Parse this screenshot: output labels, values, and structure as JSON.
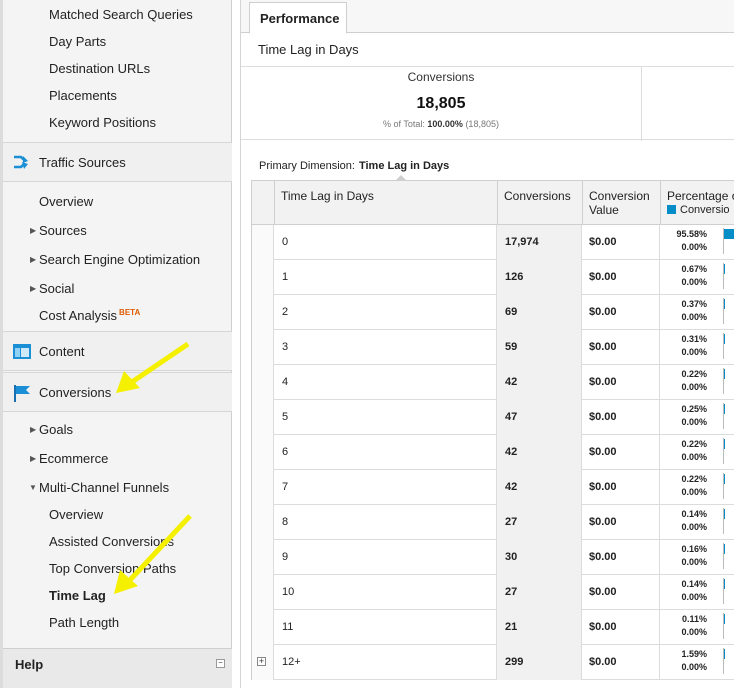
{
  "sidebar": {
    "top_items": [
      "Matched Search Queries",
      "Day Parts",
      "Destination URLs",
      "Placements",
      "Keyword Positions"
    ],
    "traffic_sources": {
      "label": "Traffic Sources",
      "items": [
        {
          "label": "Overview",
          "expandable": false
        },
        {
          "label": "Sources",
          "expandable": true
        },
        {
          "label": "Search Engine Optimization",
          "expandable": true
        },
        {
          "label": "Social",
          "expandable": true
        },
        {
          "label": "Cost Analysis",
          "expandable": false,
          "badge": "BETA"
        }
      ]
    },
    "content": {
      "label": "Content"
    },
    "conversions": {
      "label": "Conversions",
      "items": [
        {
          "label": "Goals",
          "expandable": true
        },
        {
          "label": "Ecommerce",
          "expandable": true
        },
        {
          "label": "Multi-Channel Funnels",
          "expanded": true
        }
      ],
      "mcf_items": [
        "Overview",
        "Assisted Conversions",
        "Top Conversion Paths",
        "Time Lag",
        "Path Length"
      ],
      "active_item": "Time Lag"
    },
    "help": {
      "label": "Help"
    }
  },
  "main": {
    "tab": "Performance",
    "report_title": "Time Lag in Days",
    "summary": {
      "label": "Conversions",
      "value": "18,805",
      "total_prefix": "% of Total:",
      "total_bold": "100.00%",
      "total_suffix": "(18,805)"
    },
    "primary_dimension": {
      "label": "Primary Dimension:",
      "value": "Time Lag in Days"
    },
    "table": {
      "headers": {
        "lag": "Time Lag in Days",
        "conversions": "Conversions",
        "value": "Conversion Value",
        "pct": "Percentage o",
        "legend": "Conversio"
      },
      "rows": [
        {
          "lag": "0",
          "conversions": "17,974",
          "value": "$0.00",
          "pct": "95.58%",
          "pct2": "0.00%",
          "share": 95.58
        },
        {
          "lag": "1",
          "conversions": "126",
          "value": "$0.00",
          "pct": "0.67%",
          "pct2": "0.00%",
          "share": 0.67
        },
        {
          "lag": "2",
          "conversions": "69",
          "value": "$0.00",
          "pct": "0.37%",
          "pct2": "0.00%",
          "share": 0.37
        },
        {
          "lag": "3",
          "conversions": "59",
          "value": "$0.00",
          "pct": "0.31%",
          "pct2": "0.00%",
          "share": 0.31
        },
        {
          "lag": "4",
          "conversions": "42",
          "value": "$0.00",
          "pct": "0.22%",
          "pct2": "0.00%",
          "share": 0.22
        },
        {
          "lag": "5",
          "conversions": "47",
          "value": "$0.00",
          "pct": "0.25%",
          "pct2": "0.00%",
          "share": 0.25
        },
        {
          "lag": "6",
          "conversions": "42",
          "value": "$0.00",
          "pct": "0.22%",
          "pct2": "0.00%",
          "share": 0.22
        },
        {
          "lag": "7",
          "conversions": "42",
          "value": "$0.00",
          "pct": "0.22%",
          "pct2": "0.00%",
          "share": 0.22
        },
        {
          "lag": "8",
          "conversions": "27",
          "value": "$0.00",
          "pct": "0.14%",
          "pct2": "0.00%",
          "share": 0.14
        },
        {
          "lag": "9",
          "conversions": "30",
          "value": "$0.00",
          "pct": "0.16%",
          "pct2": "0.00%",
          "share": 0.16
        },
        {
          "lag": "10",
          "conversions": "27",
          "value": "$0.00",
          "pct": "0.14%",
          "pct2": "0.00%",
          "share": 0.14
        },
        {
          "lag": "11",
          "conversions": "21",
          "value": "$0.00",
          "pct": "0.11%",
          "pct2": "0.00%",
          "share": 0.11
        },
        {
          "lag": "12+",
          "conversions": "299",
          "value": "$0.00",
          "pct": "1.59%",
          "pct2": "0.00%",
          "share": 1.59,
          "expandable": true
        }
      ]
    }
  },
  "colors": {
    "accent": "#058dc7",
    "annotation": "#f5f000",
    "beta": "#e05a00"
  },
  "icons": {
    "traffic_sources": "traffic-arrows-icon",
    "content": "content-window-icon",
    "conversions": "flag-icon"
  }
}
